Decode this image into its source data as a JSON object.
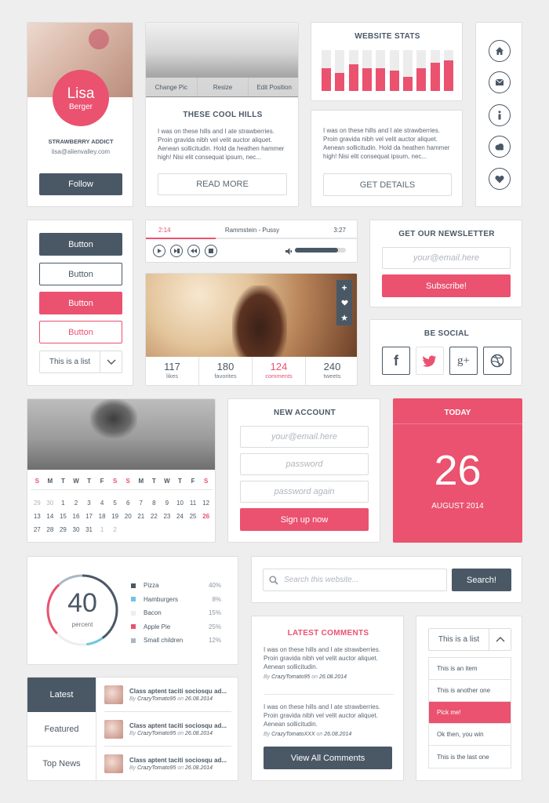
{
  "profile": {
    "first": "Lisa",
    "last": "Berger",
    "tagline": "STRAWBERRY ADDICT",
    "email": "lisa@alienvalley.com",
    "follow": "Follow"
  },
  "photo_card": {
    "tabs": [
      "Change Pic",
      "Resize",
      "Edit Position"
    ],
    "title": "THESE COOL HILLS",
    "text": "I was on these hills and I ate strawberries. Proin gravida nibh vel velit auctor aliquet. Aenean sollicitudin. Hold da heathen hammer high! Nisi elit consequat ipsum, nec...",
    "button": "READ MORE"
  },
  "stats": {
    "title": "WEBSITE STATS",
    "bars": [
      0.55,
      0.45,
      0.65,
      0.55,
      0.55,
      0.5,
      0.35,
      0.55,
      0.7,
      0.75
    ],
    "text": "I was on these hills and I ate strawberries. Proin gravida nibh vel velit auctor aliquet. Aenean sollicitudin. Hold da heathen hammer high! Nisi elit consequat ipsum, nec...",
    "button": "GET DETAILS"
  },
  "sidebar_icons": [
    "home-icon",
    "mail-icon",
    "info-icon",
    "cloud-icon",
    "heart-icon"
  ],
  "buttons": {
    "b1": "Button",
    "b2": "Button",
    "b3": "Button",
    "b4": "Button",
    "select": "This is a list"
  },
  "player": {
    "elapsed": "2:14",
    "track": "Rammstein - Pussy",
    "total": "3:27",
    "progress": 0.33,
    "volume": 0.85
  },
  "photo_stats": [
    {
      "n": "117",
      "l": "likes"
    },
    {
      "n": "180",
      "l": "favorites"
    },
    {
      "n": "124",
      "l": "comments"
    },
    {
      "n": "240",
      "l": "tweets"
    }
  ],
  "newsletter": {
    "title": "GET OUR NEWSLETTER",
    "placeholder": "your@email.here",
    "button": "Subscribe!"
  },
  "social": {
    "title": "BE SOCIAL"
  },
  "calendar": {
    "days": [
      "S",
      "M",
      "T",
      "W",
      "T",
      "F",
      "S",
      "S",
      "M",
      "T",
      "W",
      "T",
      "F",
      "S"
    ],
    "rows": [
      [
        "29",
        "30",
        "1",
        "2",
        "3",
        "4",
        "5",
        "6",
        "7",
        "8",
        "9",
        "10",
        "11",
        "12"
      ],
      [
        "13",
        "14",
        "15",
        "16",
        "17",
        "18",
        "19",
        "20",
        "21",
        "22",
        "23",
        "24",
        "25",
        "26"
      ],
      [
        "27",
        "28",
        "29",
        "30",
        "31",
        "1",
        "2",
        "",
        "",
        "",
        "",
        "",
        "",
        ""
      ]
    ]
  },
  "account": {
    "title": "NEW ACCOUNT",
    "email": "your@email.here",
    "password": "password",
    "password2": "password again",
    "button": "Sign up now"
  },
  "today": {
    "title": "TODAY",
    "day": "26",
    "month": "AUGUST 2014"
  },
  "donut": {
    "value": "40",
    "label": "percent",
    "items": [
      {
        "name": "Pizza",
        "pct": "40%",
        "color": "#4a5866",
        "v": 40
      },
      {
        "name": "Hamburgers",
        "pct": "8%",
        "color": "#6ec5e2",
        "v": 8
      },
      {
        "name": "Bacon",
        "pct": "15%",
        "color": "#eeeeee",
        "v": 15
      },
      {
        "name": "Apple Pie",
        "pct": "25%",
        "color": "#ea526f",
        "v": 25
      },
      {
        "name": "Small children",
        "pct": "12%",
        "color": "#a9b8c6",
        "v": 12
      }
    ]
  },
  "search": {
    "placeholder": "Search this website...",
    "button": "Search!"
  },
  "comments": {
    "title": "LATEST COMMENTS",
    "items": [
      {
        "text": "I was on these hills and I ate strawberries. Proin gravida nibh vel velit auctor aliquet. Aenean sollicitudin.",
        "by": "By",
        "user": "CrazyTomato95",
        "on": "on",
        "date": "26.08.2014"
      },
      {
        "text": "I was on these hills and I ate strawberries. Proin gravida nibh vel velit auctor aliquet. Aenean sollicitudin.",
        "by": "By",
        "user": "CrazyTomatoXXX",
        "on": "on",
        "date": "26.08.2014"
      }
    ],
    "button": "View All Comments"
  },
  "tabs": {
    "items": [
      "Latest",
      "Featured",
      "Top News"
    ],
    "posts": [
      {
        "title": "Class aptent taciti sociosqu ad...",
        "by": "By",
        "user": "CrazyTomato95",
        "on": "on",
        "date": "26.08.2014"
      },
      {
        "title": "Class aptent taciti sociosqu ad...",
        "by": "By",
        "user": "CrazyTomato95",
        "on": "on",
        "date": "26.08.2014"
      },
      {
        "title": "Class aptent taciti sociosqu ad...",
        "by": "By",
        "user": "CrazyTomato95",
        "on": "on",
        "date": "26.08.2014"
      }
    ]
  },
  "dropdown": {
    "label": "This is a list",
    "items": [
      "This is an item",
      "This is another one",
      "Pick me!",
      "Ok then, you win",
      "This is the last one"
    ],
    "selected": 2
  },
  "colors": {
    "pink": "#ea526f",
    "dark": "#4a5866"
  }
}
